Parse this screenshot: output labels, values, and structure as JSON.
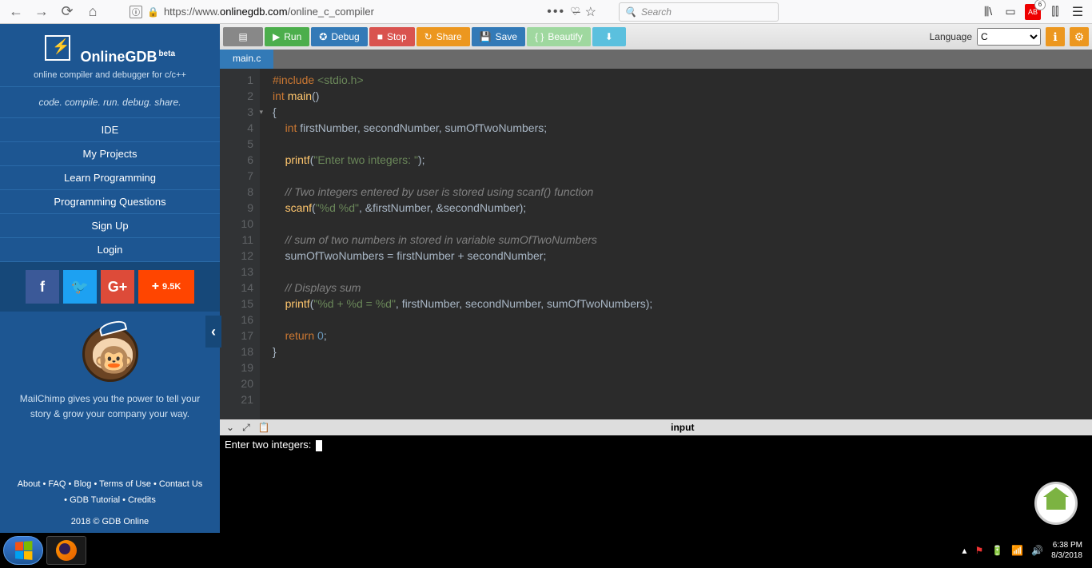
{
  "browser": {
    "url_prefix": "https://www.",
    "url_domain": "onlinegdb.com",
    "url_path": "/online_c_compiler",
    "search_placeholder": "Search"
  },
  "sidebar": {
    "title": "OnlineGDB",
    "beta": "beta",
    "subtitle": "online compiler and debugger for c/c++",
    "tagline": "code. compile. run. debug. share.",
    "links": [
      "IDE",
      "My Projects",
      "Learn Programming",
      "Programming Questions",
      "Sign Up",
      "Login"
    ],
    "share_count": "9.5K",
    "mailchimp_text": "MailChimp gives you the power to tell your story & grow your company your way.",
    "footer1": "About • FAQ • Blog • Terms of Use • Contact Us",
    "footer2": "• GDB Tutorial • Credits",
    "copyright": "2018 © GDB Online"
  },
  "toolbar": {
    "run": "Run",
    "debug": "Debug",
    "stop": "Stop",
    "share": "Share",
    "save": "Save",
    "beautify": "Beautify",
    "lang_label": "Language",
    "lang_value": "C"
  },
  "tab": "main.c",
  "code_lines": [
    {
      "n": 1,
      "html": "<span class='pp'>#include</span> <span class='inc'>&lt;stdio.h&gt;</span>"
    },
    {
      "n": 2,
      "html": "<span class='kw'>int</span> <span class='fn'>main</span>()"
    },
    {
      "n": 3,
      "html": "{",
      "fold": true
    },
    {
      "n": 4,
      "html": "    <span class='kw'>int</span> firstNumber, secondNumber, sumOfTwoNumbers;"
    },
    {
      "n": 5,
      "html": ""
    },
    {
      "n": 6,
      "html": "    <span class='fn'>printf</span>(<span class='str'>\"Enter two integers: \"</span>);"
    },
    {
      "n": 7,
      "html": ""
    },
    {
      "n": 8,
      "html": "    <span class='cmt'>// Two integers entered by user is stored using scanf() function</span>"
    },
    {
      "n": 9,
      "html": "    <span class='fn'>scanf</span>(<span class='str'>\"%d %d\"</span>, &amp;firstNumber, &amp;secondNumber);"
    },
    {
      "n": 10,
      "html": ""
    },
    {
      "n": 11,
      "html": "    <span class='cmt'>// sum of two numbers in stored in variable sumOfTwoNumbers</span>"
    },
    {
      "n": 12,
      "html": "    sumOfTwoNumbers = firstNumber + secondNumber;"
    },
    {
      "n": 13,
      "html": ""
    },
    {
      "n": 14,
      "html": "    <span class='cmt'>// Displays sum</span>"
    },
    {
      "n": 15,
      "html": "    <span class='fn'>printf</span>(<span class='str'>\"%d + %d = %d\"</span>, firstNumber, secondNumber, sumOfTwoNumbers);"
    },
    {
      "n": 16,
      "html": ""
    },
    {
      "n": 17,
      "html": "    <span class='kw'>return</span> <span class='num'>0</span>;"
    },
    {
      "n": 18,
      "html": "}"
    },
    {
      "n": 19,
      "html": ""
    },
    {
      "n": 20,
      "html": ""
    },
    {
      "n": 21,
      "html": ""
    }
  ],
  "console": {
    "title": "input",
    "output": "Enter two integers: "
  },
  "taskbar": {
    "time": "6:38 PM",
    "date": "8/3/2018"
  }
}
